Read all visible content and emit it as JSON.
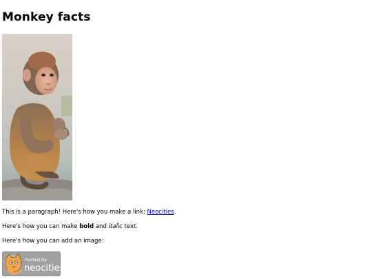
{
  "page": {
    "title": "Monkey facts"
  },
  "image": {
    "alt": "monkey-photo"
  },
  "paragraph1": {
    "before_link": "This is a paragraph! Here's how you make a link: ",
    "link_text": "Neocities",
    "after_link": "."
  },
  "paragraph2": {
    "before_bold": "Here's how you can make ",
    "bold_text": "bold",
    "between": " and ",
    "italic_text": "italic",
    "after_italic": " text."
  },
  "paragraph3": {
    "text": "Here's how you can add an image:"
  },
  "badge": {
    "small_text": "hosted by",
    "brand_text": "neocities"
  },
  "colors": {
    "link": "#0000ee",
    "badge_bg": "#a1a1a1",
    "cat_orange": "#f0a64a"
  }
}
